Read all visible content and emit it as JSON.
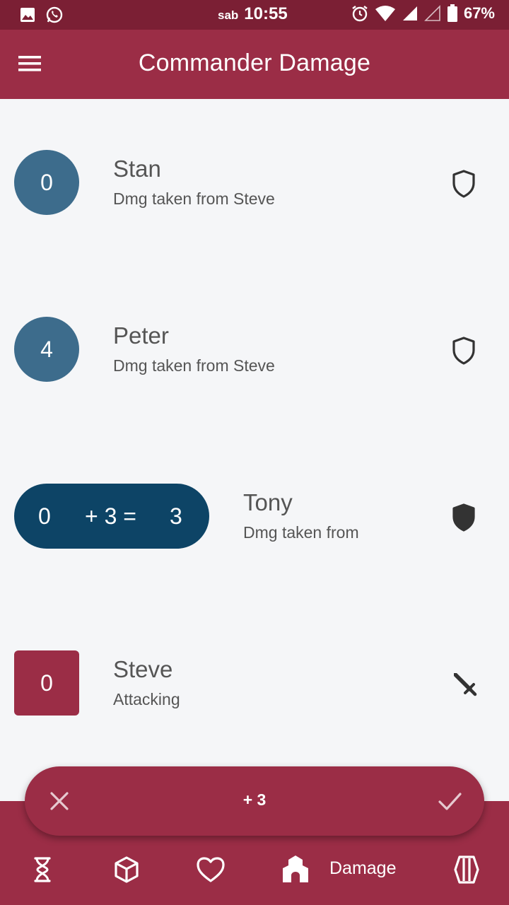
{
  "status_bar": {
    "day": "sab",
    "time": "10:55",
    "battery": "67%",
    "icons": [
      "gallery-icon",
      "whatsapp-icon",
      "alarm-icon",
      "wifi-icon",
      "signal-icon",
      "signal-empty-icon",
      "battery-icon"
    ]
  },
  "app_bar": {
    "title": "Commander Damage",
    "menu_icon": "hamburger-menu-icon"
  },
  "players": [
    {
      "name": "Stan",
      "subtitle": "Dmg taken from Steve",
      "damage": "0",
      "trail_icon": "shield-outline-icon"
    },
    {
      "name": "Peter",
      "subtitle": "Dmg taken from Steve",
      "damage": "4",
      "trail_icon": "shield-outline-icon"
    },
    {
      "name": "Tony",
      "subtitle": "Dmg taken from",
      "damage_before": "0",
      "damage_change": "+ 3 =",
      "damage_after": "3",
      "trail_icon": "shield-filled-icon"
    },
    {
      "name": "Steve",
      "subtitle": "Attacking",
      "damage": "0",
      "trail_icon": "sword-icon"
    }
  ],
  "action_bar": {
    "value": "+ 3",
    "cancel_icon": "close-icon",
    "confirm_icon": "check-icon"
  },
  "bottom_nav": {
    "items": [
      {
        "icon": "hourglass-icon"
      },
      {
        "icon": "cube-icon"
      },
      {
        "icon": "heart-icon"
      },
      {
        "icon": "castle-icon",
        "label": "Damage",
        "active": true
      },
      {
        "icon": "cards-icon"
      }
    ]
  },
  "colors": {
    "status_bar": "#7b1f34",
    "primary": "#9b2d46",
    "circle": "#3d6c8c",
    "pill": "#0d4466",
    "background": "#f5f6f8"
  }
}
